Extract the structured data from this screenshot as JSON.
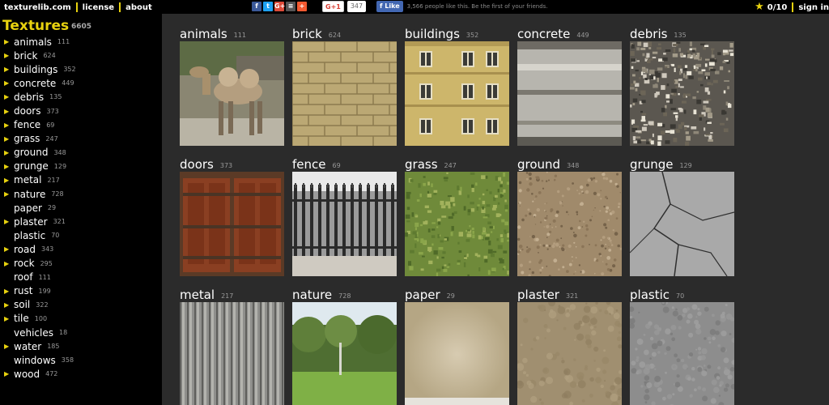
{
  "topbar": {
    "site": "texturelib.com",
    "license": "license",
    "about": "about",
    "share": [
      {
        "icon": "facebook-icon",
        "glyph": "f",
        "color": "#3b5998"
      },
      {
        "icon": "twitter-icon",
        "glyph": "t",
        "color": "#1da1f2"
      },
      {
        "icon": "google-plus-icon",
        "glyph": "G+",
        "color": "#dd4b39"
      },
      {
        "icon": "buffer-icon",
        "glyph": "≡",
        "color": "#555555"
      },
      {
        "icon": "addthis-icon",
        "glyph": "+",
        "color": "#f35930"
      }
    ],
    "gplus_label": "G+1",
    "gplus_count": "347",
    "fb_label": "f Like",
    "fb_text": "3,566 people like this. Be the first of your friends.",
    "favorites": "0/10",
    "signin": "sign in"
  },
  "sidebar": {
    "title": "Textures",
    "total": "6605",
    "items": [
      {
        "label": "animals",
        "count": "111",
        "arrow": true
      },
      {
        "label": "brick",
        "count": "624",
        "arrow": true
      },
      {
        "label": "buildings",
        "count": "352",
        "arrow": true
      },
      {
        "label": "concrete",
        "count": "449",
        "arrow": true
      },
      {
        "label": "debris",
        "count": "135",
        "arrow": true
      },
      {
        "label": "doors",
        "count": "373",
        "arrow": true
      },
      {
        "label": "fence",
        "count": "69",
        "arrow": true
      },
      {
        "label": "grass",
        "count": "247",
        "arrow": true
      },
      {
        "label": "ground",
        "count": "348",
        "arrow": true
      },
      {
        "label": "grunge",
        "count": "129",
        "arrow": true
      },
      {
        "label": "metal",
        "count": "217",
        "arrow": true
      },
      {
        "label": "nature",
        "count": "728",
        "arrow": true
      },
      {
        "label": "paper",
        "count": "29",
        "arrow": false
      },
      {
        "label": "plaster",
        "count": "321",
        "arrow": true
      },
      {
        "label": "plastic",
        "count": "70",
        "arrow": false
      },
      {
        "label": "road",
        "count": "343",
        "arrow": true
      },
      {
        "label": "rock",
        "count": "295",
        "arrow": true
      },
      {
        "label": "roof",
        "count": "111",
        "arrow": false
      },
      {
        "label": "rust",
        "count": "199",
        "arrow": true
      },
      {
        "label": "soil",
        "count": "322",
        "arrow": true
      },
      {
        "label": "tile",
        "count": "100",
        "arrow": true
      },
      {
        "label": "vehicles",
        "count": "18",
        "arrow": false
      },
      {
        "label": "water",
        "count": "185",
        "arrow": true
      },
      {
        "label": "windows",
        "count": "358",
        "arrow": false
      },
      {
        "label": "wood",
        "count": "472",
        "arrow": true
      }
    ]
  },
  "tiles": [
    {
      "name": "animals",
      "count": "111",
      "thumb": "camel"
    },
    {
      "name": "brick",
      "count": "624",
      "thumb": "brick"
    },
    {
      "name": "buildings",
      "count": "352",
      "thumb": "building"
    },
    {
      "name": "concrete",
      "count": "449",
      "thumb": "concrete"
    },
    {
      "name": "debris",
      "count": "135",
      "thumb": "debris"
    },
    {
      "name": "doors",
      "count": "373",
      "thumb": "doors"
    },
    {
      "name": "fence",
      "count": "69",
      "thumb": "fence"
    },
    {
      "name": "grass",
      "count": "247",
      "thumb": "grass"
    },
    {
      "name": "ground",
      "count": "348",
      "thumb": "ground"
    },
    {
      "name": "grunge",
      "count": "129",
      "thumb": "grunge"
    },
    {
      "name": "metal",
      "count": "217",
      "thumb": "metal"
    },
    {
      "name": "nature",
      "count": "728",
      "thumb": "nature"
    },
    {
      "name": "paper",
      "count": "29",
      "thumb": "paper"
    },
    {
      "name": "plaster",
      "count": "321",
      "thumb": "plaster"
    },
    {
      "name": "plastic",
      "count": "70",
      "thumb": "plastic"
    }
  ],
  "colors": {
    "accent": "#e8d20f",
    "sidebar_bg": "#000000",
    "content_bg": "#2b2b2b"
  }
}
